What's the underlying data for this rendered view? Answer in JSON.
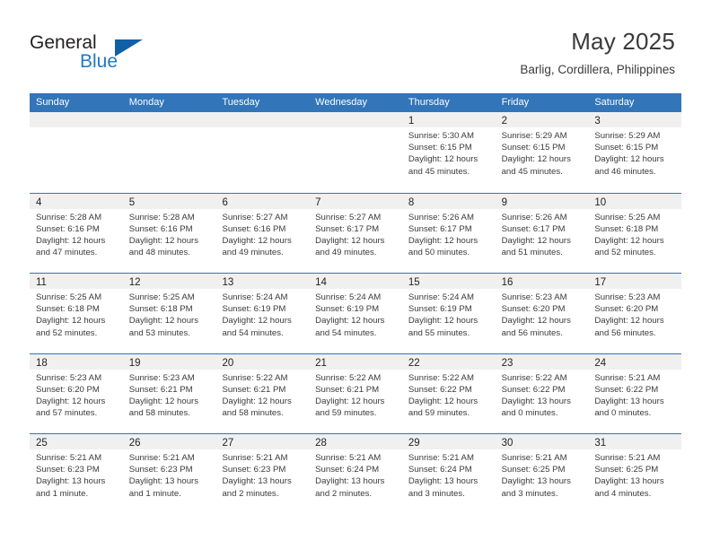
{
  "brand": {
    "name_part1": "General",
    "name_part2": "Blue",
    "accent_color": "#1060a8",
    "logo_blue_color": "#1f7ac4"
  },
  "header": {
    "title": "May 2025",
    "subtitle": "Barlig, Cordillera, Philippines",
    "header_bg_color": "#3275b9",
    "daynum_band_color": "#f0f0f0"
  },
  "weekdays": [
    "Sunday",
    "Monday",
    "Tuesday",
    "Wednesday",
    "Thursday",
    "Friday",
    "Saturday"
  ],
  "weeks": [
    [
      {
        "day": "",
        "empty": true
      },
      {
        "day": "",
        "empty": true
      },
      {
        "day": "",
        "empty": true
      },
      {
        "day": "",
        "empty": true
      },
      {
        "day": "1",
        "sunrise": "Sunrise: 5:30 AM",
        "sunset": "Sunset: 6:15 PM",
        "daylight_line1": "Daylight: 12 hours",
        "daylight_line2": "and 45 minutes."
      },
      {
        "day": "2",
        "sunrise": "Sunrise: 5:29 AM",
        "sunset": "Sunset: 6:15 PM",
        "daylight_line1": "Daylight: 12 hours",
        "daylight_line2": "and 45 minutes."
      },
      {
        "day": "3",
        "sunrise": "Sunrise: 5:29 AM",
        "sunset": "Sunset: 6:15 PM",
        "daylight_line1": "Daylight: 12 hours",
        "daylight_line2": "and 46 minutes."
      }
    ],
    [
      {
        "day": "4",
        "sunrise": "Sunrise: 5:28 AM",
        "sunset": "Sunset: 6:16 PM",
        "daylight_line1": "Daylight: 12 hours",
        "daylight_line2": "and 47 minutes."
      },
      {
        "day": "5",
        "sunrise": "Sunrise: 5:28 AM",
        "sunset": "Sunset: 6:16 PM",
        "daylight_line1": "Daylight: 12 hours",
        "daylight_line2": "and 48 minutes."
      },
      {
        "day": "6",
        "sunrise": "Sunrise: 5:27 AM",
        "sunset": "Sunset: 6:16 PM",
        "daylight_line1": "Daylight: 12 hours",
        "daylight_line2": "and 49 minutes."
      },
      {
        "day": "7",
        "sunrise": "Sunrise: 5:27 AM",
        "sunset": "Sunset: 6:17 PM",
        "daylight_line1": "Daylight: 12 hours",
        "daylight_line2": "and 49 minutes."
      },
      {
        "day": "8",
        "sunrise": "Sunrise: 5:26 AM",
        "sunset": "Sunset: 6:17 PM",
        "daylight_line1": "Daylight: 12 hours",
        "daylight_line2": "and 50 minutes."
      },
      {
        "day": "9",
        "sunrise": "Sunrise: 5:26 AM",
        "sunset": "Sunset: 6:17 PM",
        "daylight_line1": "Daylight: 12 hours",
        "daylight_line2": "and 51 minutes."
      },
      {
        "day": "10",
        "sunrise": "Sunrise: 5:25 AM",
        "sunset": "Sunset: 6:18 PM",
        "daylight_line1": "Daylight: 12 hours",
        "daylight_line2": "and 52 minutes."
      }
    ],
    [
      {
        "day": "11",
        "sunrise": "Sunrise: 5:25 AM",
        "sunset": "Sunset: 6:18 PM",
        "daylight_line1": "Daylight: 12 hours",
        "daylight_line2": "and 52 minutes."
      },
      {
        "day": "12",
        "sunrise": "Sunrise: 5:25 AM",
        "sunset": "Sunset: 6:18 PM",
        "daylight_line1": "Daylight: 12 hours",
        "daylight_line2": "and 53 minutes."
      },
      {
        "day": "13",
        "sunrise": "Sunrise: 5:24 AM",
        "sunset": "Sunset: 6:19 PM",
        "daylight_line1": "Daylight: 12 hours",
        "daylight_line2": "and 54 minutes."
      },
      {
        "day": "14",
        "sunrise": "Sunrise: 5:24 AM",
        "sunset": "Sunset: 6:19 PM",
        "daylight_line1": "Daylight: 12 hours",
        "daylight_line2": "and 54 minutes."
      },
      {
        "day": "15",
        "sunrise": "Sunrise: 5:24 AM",
        "sunset": "Sunset: 6:19 PM",
        "daylight_line1": "Daylight: 12 hours",
        "daylight_line2": "and 55 minutes."
      },
      {
        "day": "16",
        "sunrise": "Sunrise: 5:23 AM",
        "sunset": "Sunset: 6:20 PM",
        "daylight_line1": "Daylight: 12 hours",
        "daylight_line2": "and 56 minutes."
      },
      {
        "day": "17",
        "sunrise": "Sunrise: 5:23 AM",
        "sunset": "Sunset: 6:20 PM",
        "daylight_line1": "Daylight: 12 hours",
        "daylight_line2": "and 56 minutes."
      }
    ],
    [
      {
        "day": "18",
        "sunrise": "Sunrise: 5:23 AM",
        "sunset": "Sunset: 6:20 PM",
        "daylight_line1": "Daylight: 12 hours",
        "daylight_line2": "and 57 minutes."
      },
      {
        "day": "19",
        "sunrise": "Sunrise: 5:23 AM",
        "sunset": "Sunset: 6:21 PM",
        "daylight_line1": "Daylight: 12 hours",
        "daylight_line2": "and 58 minutes."
      },
      {
        "day": "20",
        "sunrise": "Sunrise: 5:22 AM",
        "sunset": "Sunset: 6:21 PM",
        "daylight_line1": "Daylight: 12 hours",
        "daylight_line2": "and 58 minutes."
      },
      {
        "day": "21",
        "sunrise": "Sunrise: 5:22 AM",
        "sunset": "Sunset: 6:21 PM",
        "daylight_line1": "Daylight: 12 hours",
        "daylight_line2": "and 59 minutes."
      },
      {
        "day": "22",
        "sunrise": "Sunrise: 5:22 AM",
        "sunset": "Sunset: 6:22 PM",
        "daylight_line1": "Daylight: 12 hours",
        "daylight_line2": "and 59 minutes."
      },
      {
        "day": "23",
        "sunrise": "Sunrise: 5:22 AM",
        "sunset": "Sunset: 6:22 PM",
        "daylight_line1": "Daylight: 13 hours",
        "daylight_line2": "and 0 minutes."
      },
      {
        "day": "24",
        "sunrise": "Sunrise: 5:21 AM",
        "sunset": "Sunset: 6:22 PM",
        "daylight_line1": "Daylight: 13 hours",
        "daylight_line2": "and 0 minutes."
      }
    ],
    [
      {
        "day": "25",
        "sunrise": "Sunrise: 5:21 AM",
        "sunset": "Sunset: 6:23 PM",
        "daylight_line1": "Daylight: 13 hours",
        "daylight_line2": "and 1 minute."
      },
      {
        "day": "26",
        "sunrise": "Sunrise: 5:21 AM",
        "sunset": "Sunset: 6:23 PM",
        "daylight_line1": "Daylight: 13 hours",
        "daylight_line2": "and 1 minute."
      },
      {
        "day": "27",
        "sunrise": "Sunrise: 5:21 AM",
        "sunset": "Sunset: 6:23 PM",
        "daylight_line1": "Daylight: 13 hours",
        "daylight_line2": "and 2 minutes."
      },
      {
        "day": "28",
        "sunrise": "Sunrise: 5:21 AM",
        "sunset": "Sunset: 6:24 PM",
        "daylight_line1": "Daylight: 13 hours",
        "daylight_line2": "and 2 minutes."
      },
      {
        "day": "29",
        "sunrise": "Sunrise: 5:21 AM",
        "sunset": "Sunset: 6:24 PM",
        "daylight_line1": "Daylight: 13 hours",
        "daylight_line2": "and 3 minutes."
      },
      {
        "day": "30",
        "sunrise": "Sunrise: 5:21 AM",
        "sunset": "Sunset: 6:25 PM",
        "daylight_line1": "Daylight: 13 hours",
        "daylight_line2": "and 3 minutes."
      },
      {
        "day": "31",
        "sunrise": "Sunrise: 5:21 AM",
        "sunset": "Sunset: 6:25 PM",
        "daylight_line1": "Daylight: 13 hours",
        "daylight_line2": "and 4 minutes."
      }
    ]
  ]
}
